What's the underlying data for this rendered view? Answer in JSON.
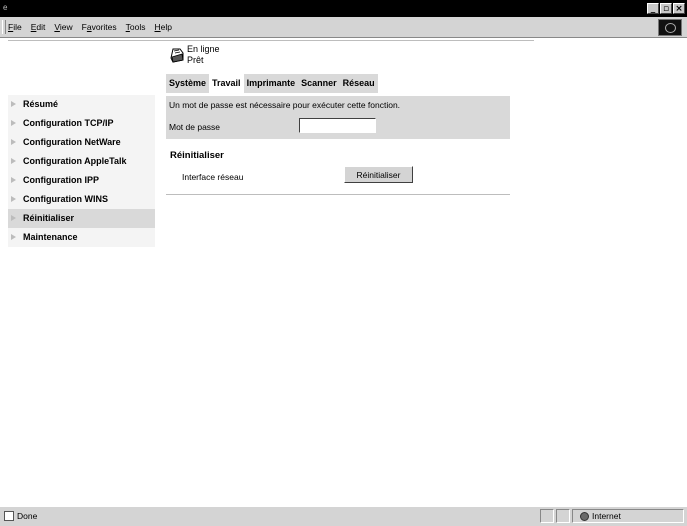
{
  "menubar": {
    "items": [
      {
        "label": "File",
        "key": "F"
      },
      {
        "label": "Edit",
        "key": "E"
      },
      {
        "label": "View",
        "key": "V"
      },
      {
        "label": "Favorites",
        "key": "a"
      },
      {
        "label": "Tools",
        "key": "T"
      },
      {
        "label": "Help",
        "key": "H"
      }
    ]
  },
  "status": {
    "online": "En ligne",
    "ready": "Prêt"
  },
  "tabs": [
    {
      "label": "Système",
      "active": false
    },
    {
      "label": "Travail",
      "active": true
    },
    {
      "label": "Imprimante",
      "active": false
    },
    {
      "label": "Scanner",
      "active": false
    },
    {
      "label": "Réseau",
      "active": false
    }
  ],
  "sidebar": {
    "items": [
      {
        "label": "Résumé",
        "active": false
      },
      {
        "label": "Configuration TCP/IP",
        "active": false
      },
      {
        "label": "Configuration NetWare",
        "active": false
      },
      {
        "label": "Configuration AppleTalk",
        "active": false
      },
      {
        "label": "Configuration IPP",
        "active": false
      },
      {
        "label": "Configuration WINS",
        "active": false
      },
      {
        "label": "Réinitialiser",
        "active": true
      },
      {
        "label": "Maintenance",
        "active": false
      }
    ]
  },
  "password": {
    "message": "Un mot de passe est nécessaire pour exécuter cette fonction.",
    "label": "Mot de passe",
    "value": ""
  },
  "reset": {
    "title": "Réinitialiser",
    "interface_label": "Interface réseau",
    "button_label": "Réinitialiser"
  },
  "statusbar": {
    "done": "Done",
    "zone": "Internet"
  },
  "colors": {
    "panel_gray": "#d9d9d9",
    "sidebar_bg": "#f4f4f4",
    "chrome": "#d4d4d4",
    "titlebar": "#000000"
  }
}
